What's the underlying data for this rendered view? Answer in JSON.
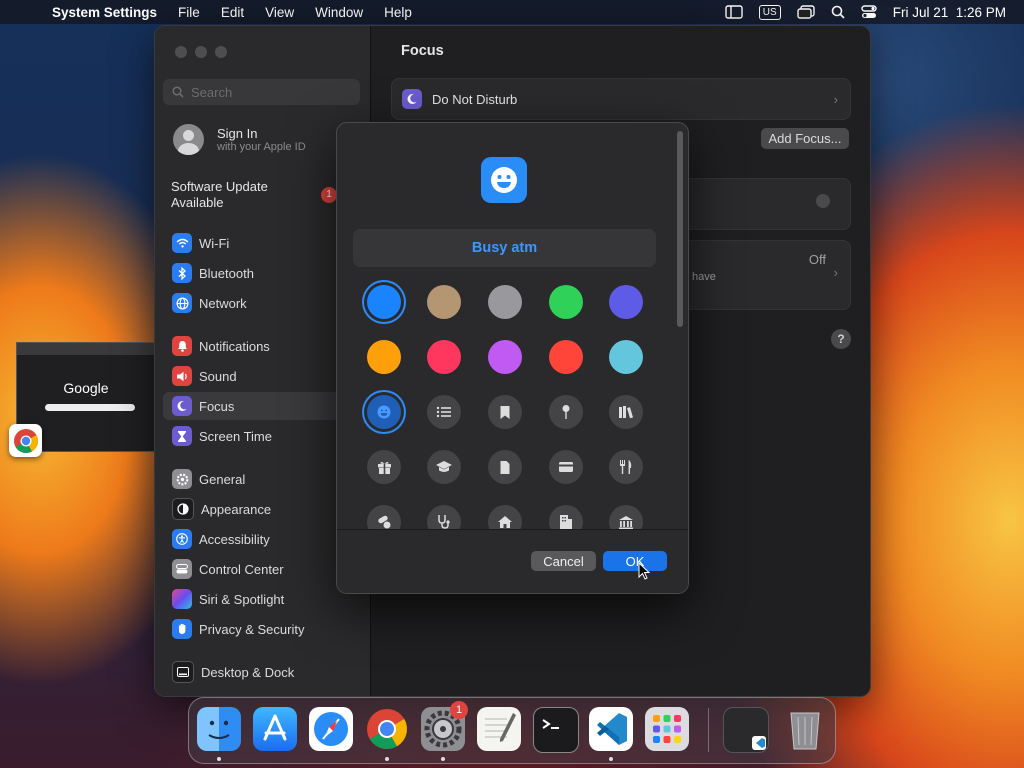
{
  "menubar": {
    "app": "System Settings",
    "items": [
      "File",
      "Edit",
      "View",
      "Window",
      "Help"
    ],
    "keyboard": "US",
    "datetime": "Fri Jul 21  1:26 PM"
  },
  "sidebar": {
    "search_placeholder": "Search",
    "signin_title": "Sign In",
    "signin_sub": "with your Apple ID",
    "software_update": "Software Update Available",
    "update_badge": "1",
    "items": [
      {
        "label": "Wi-Fi",
        "color": "#2a7df0"
      },
      {
        "label": "Bluetooth",
        "color": "#2a7df0"
      },
      {
        "label": "Network",
        "color": "#2a7df0"
      },
      {
        "label": "Notifications",
        "color": "#e0443e"
      },
      {
        "label": "Sound",
        "color": "#e0443e"
      },
      {
        "label": "Focus",
        "color": "#6c5ccf"
      },
      {
        "label": "Screen Time",
        "color": "#6c5ccf"
      },
      {
        "label": "General",
        "color": "#8e8e93"
      },
      {
        "label": "Appearance",
        "color": "#1c1c1e"
      },
      {
        "label": "Accessibility",
        "color": "#2a7df0"
      },
      {
        "label": "Control Center",
        "color": "#8e8e93"
      },
      {
        "label": "Siri & Spotlight",
        "color": "#b04fd0"
      },
      {
        "label": "Privacy & Security",
        "color": "#2a7df0"
      },
      {
        "label": "Desktop & Dock",
        "color": "#1c1c1e"
      }
    ]
  },
  "main": {
    "title": "Focus",
    "dnd_label": "Do Not Disturb",
    "add_focus": "Add Focus...",
    "off": "Off",
    "have": "have",
    "help": "?"
  },
  "dialog": {
    "name": "Busy atm",
    "colors": [
      "#1a84ff",
      "#b59673",
      "#98989d",
      "#30d158",
      "#5e5ce6",
      "#ff9f0a",
      "#ff375f",
      "#bf5af2",
      "#ff453a",
      "#64c6dc"
    ],
    "icons": [
      "smiley-icon",
      "list-icon",
      "bookmark-icon",
      "pin-icon",
      "books-icon",
      "gift-icon",
      "graduation-cap-icon",
      "document-icon",
      "credit-card-icon",
      "fork-knife-icon",
      "pills-icon",
      "stethoscope-icon",
      "house-icon",
      "building-icon",
      "bank-icon"
    ],
    "cancel": "Cancel",
    "ok": "OK"
  },
  "thumb": {
    "google": "Google"
  },
  "dock": {
    "apps": [
      "Finder",
      "App Store",
      "Safari",
      "Chrome",
      "System Settings",
      "TextEdit",
      "Terminal",
      "VS Code",
      "Launchpad"
    ],
    "settings_badge": "1"
  }
}
